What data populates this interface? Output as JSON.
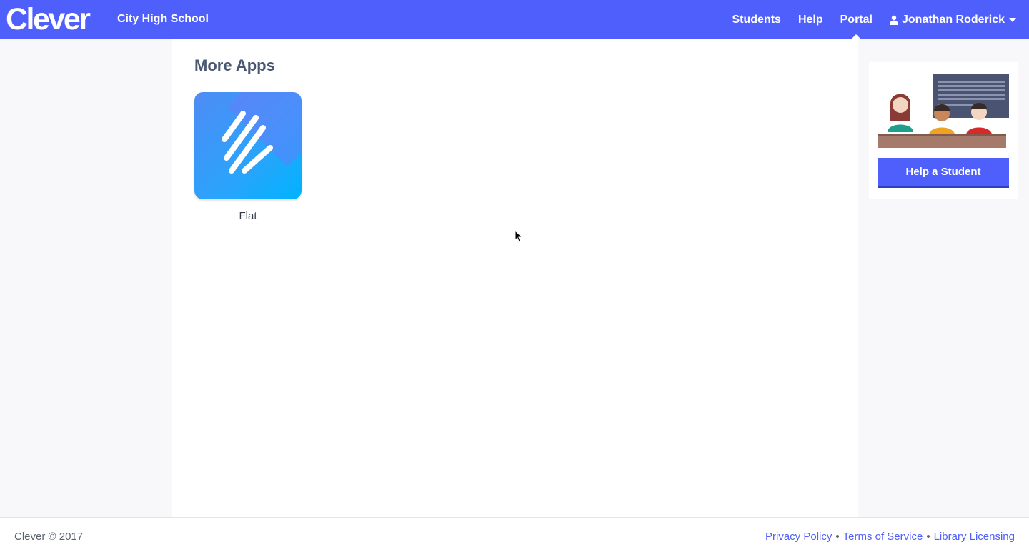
{
  "header": {
    "logo": "Clever",
    "school": "City High School",
    "nav": {
      "students": "Students",
      "help": "Help",
      "portal": "Portal",
      "user": "Jonathan Roderick"
    },
    "brand_color": "#4f5ffc"
  },
  "main": {
    "section_title": "More Apps",
    "apps": [
      {
        "label": "Flat",
        "icon": "flat-app-icon"
      }
    ]
  },
  "sidebar": {
    "help_button": "Help a Student",
    "illustration": "classroom-illustration"
  },
  "footer": {
    "copyright": "Clever © 2017",
    "links": [
      "Privacy Policy",
      "Terms of Service",
      "Library Licensing"
    ],
    "separator": "•"
  }
}
